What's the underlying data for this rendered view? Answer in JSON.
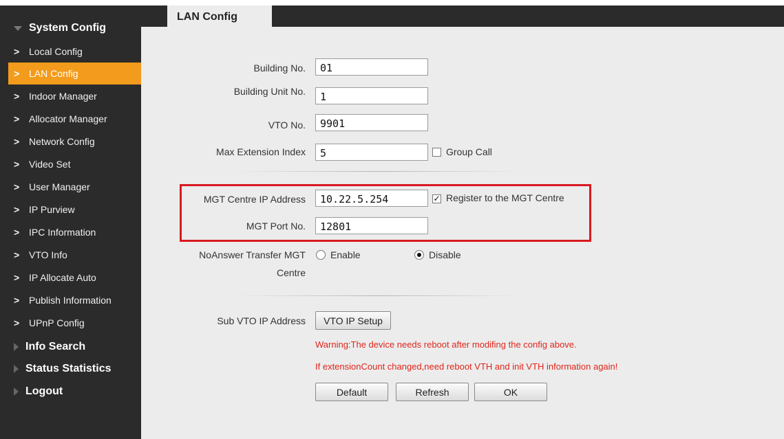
{
  "sidebar": {
    "system_config": "System Config",
    "items": [
      {
        "label": "Local Config"
      },
      {
        "label": "LAN Config"
      },
      {
        "label": "Indoor Manager"
      },
      {
        "label": "Allocator Manager"
      },
      {
        "label": "Network Config"
      },
      {
        "label": "Video Set"
      },
      {
        "label": "User Manager"
      },
      {
        "label": "IP Purview"
      },
      {
        "label": "IPC Information"
      },
      {
        "label": "VTO Info"
      },
      {
        "label": "IP Allocate Auto"
      },
      {
        "label": "Publish Information"
      },
      {
        "label": "UPnP Config"
      }
    ],
    "info_search": "Info Search",
    "status_statistics": "Status Statistics",
    "logout": "Logout",
    "active_item": "LAN Config"
  },
  "tab": {
    "title": "LAN Config"
  },
  "form": {
    "building_no": {
      "label": "Building No.",
      "value": "01"
    },
    "building_unit_no": {
      "label": "Building Unit No.",
      "value": "1"
    },
    "vto_no": {
      "label": "VTO No.",
      "value": "9901"
    },
    "max_extension_index": {
      "label": "Max Extension Index",
      "value": "5"
    },
    "group_call": {
      "label": "Group Call",
      "checked": false
    },
    "mgt_ip": {
      "label": "MGT Centre IP Address",
      "value": "10.22.5.254"
    },
    "register_mgt": {
      "label": "Register to the MGT Centre",
      "checked": true
    },
    "mgt_port": {
      "label": "MGT Port No.",
      "value": "12801"
    },
    "noanswer": {
      "label_line1": "NoAnswer Transfer MGT",
      "label_line2": "Centre",
      "enable": "Enable",
      "disable": "Disable",
      "selected": "Disable"
    },
    "sub_vto": {
      "label": "Sub VTO IP Address",
      "button": "VTO IP Setup"
    }
  },
  "warnings": [
    "Warning:The device needs reboot after modifing the config above.",
    "If extensionCount changed,need reboot VTH and init VTH information again!"
  ],
  "buttons": {
    "default": "Default",
    "refresh": "Refresh",
    "ok": "OK"
  },
  "colors": {
    "sidebar_bg": "#2b2b2b",
    "active_item": "#f39b1c",
    "main_bg": "#ececec",
    "highlight_box": "#d71920",
    "warning_text": "#e0251b"
  }
}
